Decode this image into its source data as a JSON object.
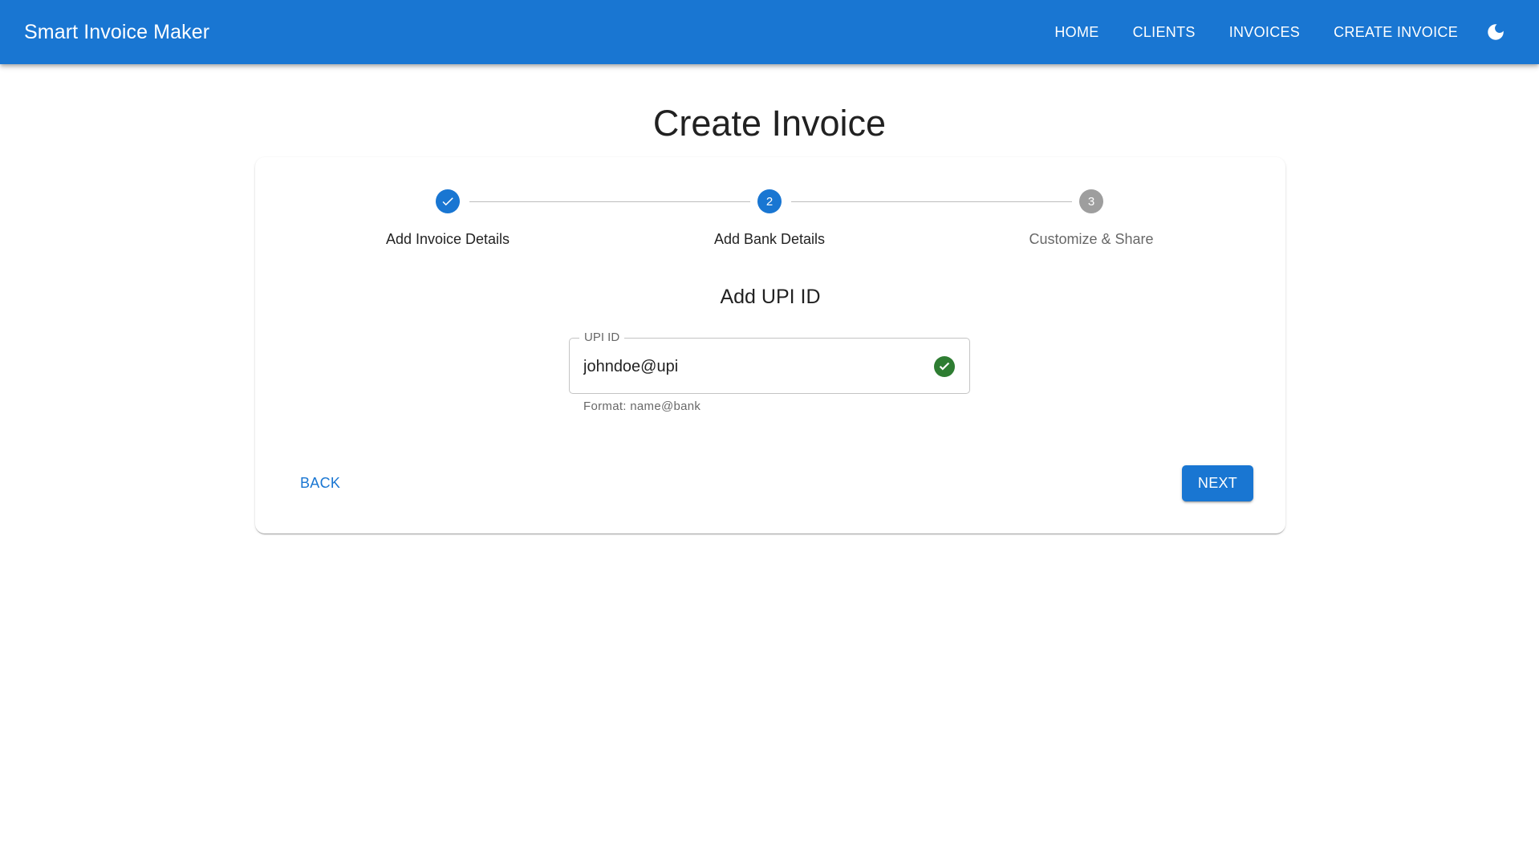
{
  "app": {
    "title": "Smart Invoice Maker",
    "nav": [
      "HOME",
      "CLIENTS",
      "INVOICES",
      "CREATE INVOICE"
    ],
    "theme_toggle_icon": "moon-icon"
  },
  "page": {
    "title": "Create Invoice"
  },
  "stepper": {
    "steps": [
      {
        "label": "Add Invoice Details",
        "state": "completed",
        "indicator": "check-icon"
      },
      {
        "label": "Add Bank Details",
        "state": "active",
        "indicator": "2"
      },
      {
        "label": "Customize & Share",
        "state": "pending",
        "indicator": "3"
      }
    ],
    "colors": {
      "active": "#1976d2",
      "pending": "#9e9e9e"
    }
  },
  "form": {
    "section_title": "Add UPI ID",
    "upi": {
      "label": "UPI ID",
      "value": "johndoe@upi",
      "helper": "Format: name@bank",
      "valid_icon": "check-circle-icon",
      "valid_color": "#2e7d32"
    }
  },
  "actions": {
    "back": "BACK",
    "next": "NEXT"
  },
  "colors": {
    "primary": "#1976d2"
  }
}
